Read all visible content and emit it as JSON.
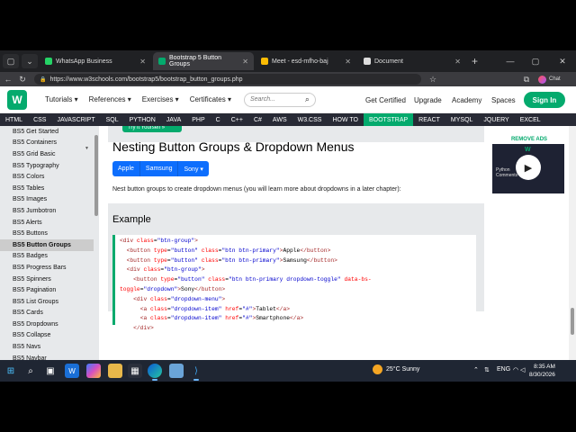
{
  "browser": {
    "tabs": [
      {
        "label": "WhatsApp Business",
        "favicon_color": "#25d366",
        "active": false
      },
      {
        "label": "Bootstrap 5 Button Groups",
        "favicon_color": "#04aa6d",
        "active": true
      },
      {
        "label": "Meet - esd-mfho-baj",
        "favicon_color": "#fbbc04",
        "active": false
      },
      {
        "label": "Document",
        "favicon_color": "#dddddd",
        "active": false
      }
    ],
    "url": "https://www.w3schools.com/bootstrap5/bootstrap_button_groups.php",
    "profile_label": "Chat"
  },
  "header": {
    "logo_text": "W",
    "logo_sub": "schools",
    "menus": [
      "Tutorials ▾",
      "References ▾",
      "Exercises ▾",
      "Certificates ▾"
    ],
    "search_placeholder": "Search...",
    "links": [
      "Get Certified",
      "Upgrade",
      "Academy",
      "Spaces"
    ],
    "signin": "Sign In"
  },
  "topnav": [
    "HTML",
    "CSS",
    "JAVASCRIPT",
    "SQL",
    "PYTHON",
    "JAVA",
    "PHP",
    "C",
    "C++",
    "C#",
    "AWS",
    "W3.CSS",
    "HOW TO",
    "BOOTSTRAP",
    "REACT",
    "MYSQL",
    "JQUERY",
    "EXCEL"
  ],
  "topnav_active": "BOOTSTRAP",
  "sidebar": {
    "items": [
      "BS5 Get Started",
      "BS5 Containers",
      "BS5 Grid Basic",
      "BS5 Typography",
      "BS5 Colors",
      "BS5 Tables",
      "BS5 Images",
      "BS5 Jumbotron",
      "BS5 Alerts",
      "BS5 Buttons",
      "BS5 Button Groups",
      "BS5 Badges",
      "BS5 Progress Bars",
      "BS5 Spinners",
      "BS5 Pagination",
      "BS5 List Groups",
      "BS5 Cards",
      "BS5 Dropdowns",
      "BS5 Collapse",
      "BS5 Navs",
      "BS5 Navbar"
    ],
    "active": "BS5 Button Groups"
  },
  "main": {
    "tryit_label": "Try it Yourself »",
    "heading": "Nesting Button Groups & Dropdown Menus",
    "buttons": [
      "Apple",
      "Samsung",
      "Sony ▾"
    ],
    "description": "Nest button groups to create dropdown menus (you will learn more about dropdowns in a later chapter):",
    "example_title": "Example",
    "code_lines": [
      [
        [
          "tag",
          "<div "
        ],
        [
          "attr",
          "class"
        ],
        [
          "txt",
          "="
        ],
        [
          "val",
          "\"btn-group\""
        ],
        [
          "tag",
          ">"
        ]
      ],
      [
        [
          "txt",
          "  "
        ],
        [
          "tag",
          "<button "
        ],
        [
          "attr",
          "type"
        ],
        [
          "txt",
          "="
        ],
        [
          "val",
          "\"button\" "
        ],
        [
          "attr",
          "class"
        ],
        [
          "txt",
          "="
        ],
        [
          "val",
          "\"btn btn-primary\""
        ],
        [
          "tag",
          ">"
        ],
        [
          "txt",
          "Apple"
        ],
        [
          "tag",
          "</button>"
        ]
      ],
      [
        [
          "txt",
          "  "
        ],
        [
          "tag",
          "<button "
        ],
        [
          "attr",
          "type"
        ],
        [
          "txt",
          "="
        ],
        [
          "val",
          "\"button\" "
        ],
        [
          "attr",
          "class"
        ],
        [
          "txt",
          "="
        ],
        [
          "val",
          "\"btn btn-primary\""
        ],
        [
          "tag",
          ">"
        ],
        [
          "txt",
          "Samsung"
        ],
        [
          "tag",
          "</button>"
        ]
      ],
      [
        [
          "txt",
          "  "
        ],
        [
          "tag",
          "<div "
        ],
        [
          "attr",
          "class"
        ],
        [
          "txt",
          "="
        ],
        [
          "val",
          "\"btn-group\""
        ],
        [
          "tag",
          ">"
        ]
      ],
      [
        [
          "txt",
          "    "
        ],
        [
          "tag",
          "<button "
        ],
        [
          "attr",
          "type"
        ],
        [
          "txt",
          "="
        ],
        [
          "val",
          "\"button\" "
        ],
        [
          "attr",
          "class"
        ],
        [
          "txt",
          "="
        ],
        [
          "val",
          "\"btn btn-primary dropdown-toggle\" "
        ],
        [
          "attr",
          "data-bs-"
        ]
      ],
      [
        [
          "attr",
          "toggle"
        ],
        [
          "txt",
          "="
        ],
        [
          "val",
          "\"dropdown\""
        ],
        [
          "tag",
          ">"
        ],
        [
          "txt",
          "Sony"
        ],
        [
          "tag",
          "</button>"
        ]
      ],
      [
        [
          "txt",
          "    "
        ],
        [
          "tag",
          "<div "
        ],
        [
          "attr",
          "class"
        ],
        [
          "txt",
          "="
        ],
        [
          "val",
          "\"dropdown-menu\""
        ],
        [
          "tag",
          ">"
        ]
      ],
      [
        [
          "txt",
          "      "
        ],
        [
          "tag",
          "<a "
        ],
        [
          "attr",
          "class"
        ],
        [
          "txt",
          "="
        ],
        [
          "val",
          "\"dropdown-item\" "
        ],
        [
          "attr",
          "href"
        ],
        [
          "txt",
          "="
        ],
        [
          "val",
          "\"#\""
        ],
        [
          "tag",
          ">"
        ],
        [
          "txt",
          "Tablet"
        ],
        [
          "tag",
          "</a>"
        ]
      ],
      [
        [
          "txt",
          "      "
        ],
        [
          "tag",
          "<a "
        ],
        [
          "attr",
          "class"
        ],
        [
          "txt",
          "="
        ],
        [
          "val",
          "\"dropdown-item\" "
        ],
        [
          "attr",
          "href"
        ],
        [
          "txt",
          "="
        ],
        [
          "val",
          "\"#\""
        ],
        [
          "tag",
          ">"
        ],
        [
          "txt",
          "Smartphone"
        ],
        [
          "tag",
          "</a>"
        ]
      ],
      [
        [
          "txt",
          "    "
        ],
        [
          "tag",
          "</div>"
        ]
      ]
    ]
  },
  "right_panel": {
    "remove_ads": "REMOVE ADS",
    "ad_logo": "W",
    "ad_text": "Python Comments"
  },
  "taskbar": {
    "weather": "25°C  Sunny",
    "lang": "ENG",
    "time": "8:35 AM",
    "date": "8/30/2026"
  },
  "colors": {
    "w3_green": "#04aa6d",
    "bootstrap_blue": "#0d6efd",
    "topnav_bg": "#282a35"
  }
}
